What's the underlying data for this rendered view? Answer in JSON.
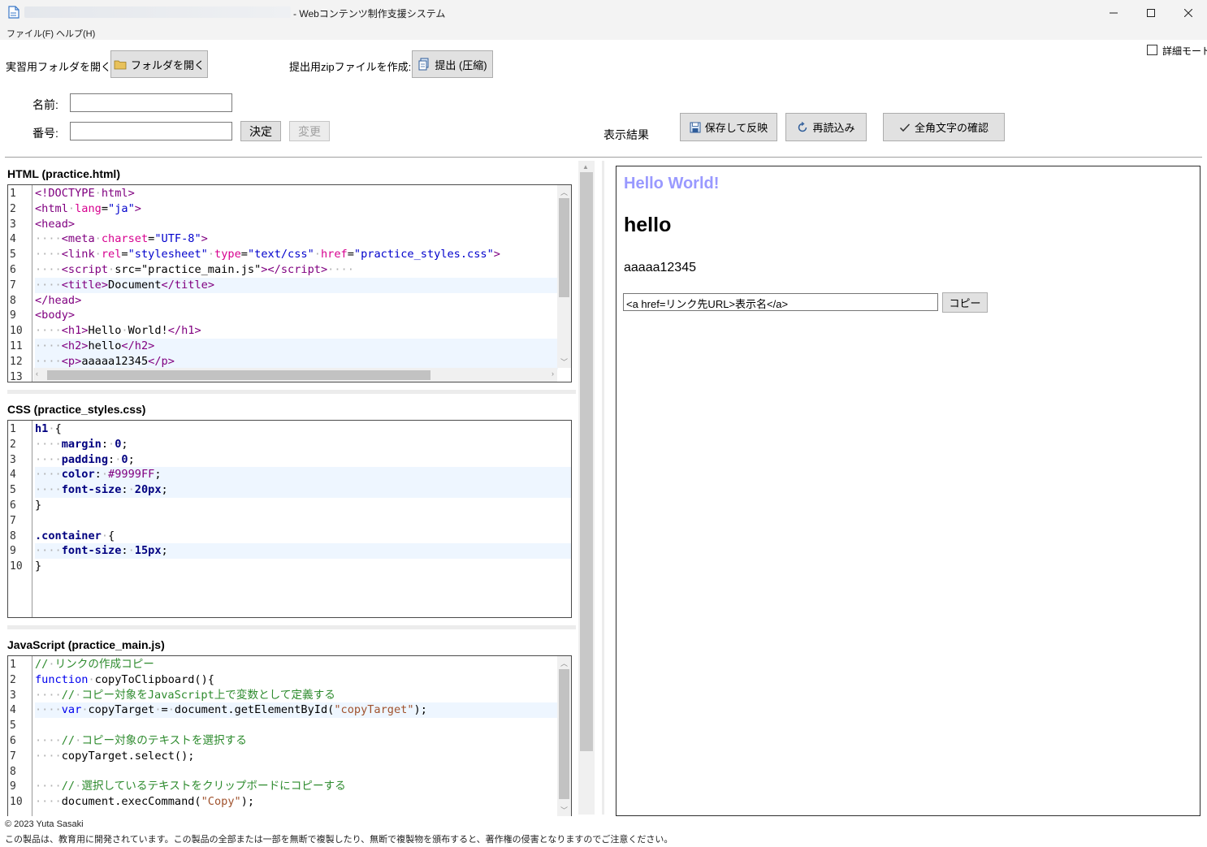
{
  "window": {
    "title": "- Webコンテンツ制作支援システム",
    "minimize": "—",
    "maximize": "☐",
    "close": "✕"
  },
  "menu": [
    "ファイル(F)",
    "ヘルプ(H)"
  ],
  "toolbar": {
    "open_folder_label": "実習用フォルダを開く:",
    "open_folder_button": "フォルダを開く",
    "zip_label": "提出用zipファイルを作成:",
    "zip_button": "提出 (圧縮)",
    "detail_mode": "詳細モード"
  },
  "form": {
    "name_label": "名前:",
    "name_value": "",
    "number_label": "番号:",
    "number_value": "",
    "confirm_button": "決定",
    "change_button": "変更"
  },
  "result": {
    "label": "表示結果",
    "save_button": "保存して反映",
    "reload_button": "再読込み",
    "check_button": "全角文字の確認"
  },
  "editors": {
    "html": {
      "label": "HTML (practice.html)",
      "line_numbers": [
        "1",
        "2",
        "3",
        "4",
        "5",
        "6",
        "7",
        "8",
        "9",
        "10",
        "11",
        "12",
        "13"
      ]
    },
    "css": {
      "label": "CSS (practice_styles.css)",
      "line_numbers": [
        "1",
        "2",
        "3",
        "4",
        "5",
        "6",
        "7",
        "8",
        "9",
        "10"
      ]
    },
    "js": {
      "label": "JavaScript (practice_main.js)",
      "line_numbers": [
        "1",
        "2",
        "3",
        "4",
        "5",
        "6",
        "7",
        "8",
        "9",
        "10"
      ]
    }
  },
  "preview": {
    "h1": "Hello World!",
    "h2": "hello",
    "p": "aaaaa12345",
    "input_value": "<a href=リンク先URL>表示名</a>",
    "copy_button": "コピー"
  },
  "footer": {
    "copyright": "© 2023 Yuta Sasaki",
    "notice": "この製品は、教育用に開発されています。この製品の全部または一部を無断で複製したり、無断で複製物を頒布すると、著作権の侵害となりますのでご注意ください。"
  },
  "colors": {
    "title_bar": "#f3f3f3",
    "h1_color": "#9999FF",
    "button_face": "#e1e1e1",
    "comment": "#2e8b2e",
    "tag": "#800080"
  }
}
